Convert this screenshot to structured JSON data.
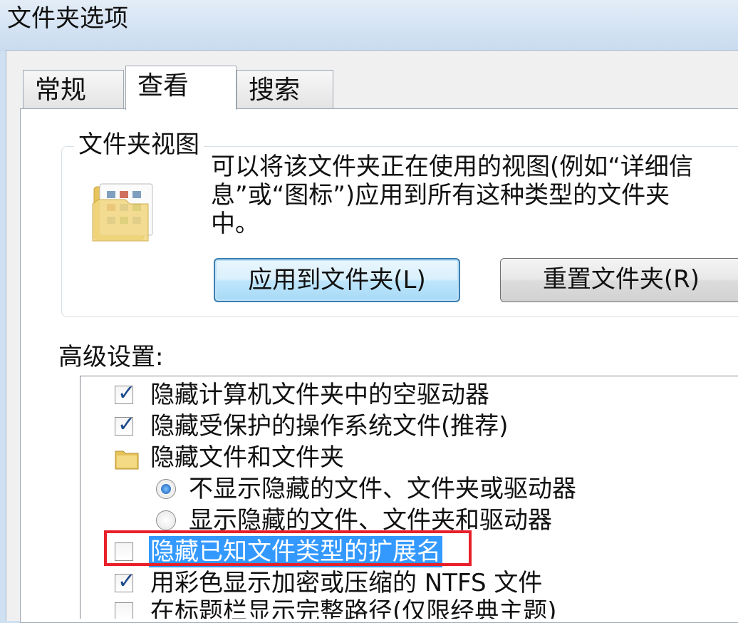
{
  "window": {
    "title": "文件夹选项"
  },
  "tabs": [
    {
      "label": "常规",
      "active": false
    },
    {
      "label": "查看",
      "active": true
    },
    {
      "label": "搜索",
      "active": false
    }
  ],
  "folder_views": {
    "title": "文件夹视图",
    "description_line1": "可以将该文件夹正在使用的视图(例如“详细信",
    "description_line2": "息”或“图标”)应用到所有这种类型的文件夹",
    "description_line3": "中。",
    "apply_button": "应用到文件夹(L)",
    "reset_button": "重置文件夹(R)"
  },
  "advanced": {
    "label": "高级设置:",
    "items": [
      {
        "type": "checkbox",
        "checked": true,
        "label": "隐藏计算机文件夹中的空驱动器"
      },
      {
        "type": "checkbox",
        "checked": true,
        "label": "隐藏受保护的操作系统文件(推荐)"
      },
      {
        "type": "folder",
        "label": "隐藏文件和文件夹"
      },
      {
        "type": "radio",
        "selected": true,
        "label": "不显示隐藏的文件、文件夹或驱动器"
      },
      {
        "type": "radio",
        "selected": false,
        "label": "显示隐藏的文件、文件夹和驱动器"
      },
      {
        "type": "checkbox",
        "checked": false,
        "highlighted": true,
        "label": "隐藏已知文件类型的扩展名"
      },
      {
        "type": "checkbox",
        "checked": true,
        "label": "用彩色显示加密或压缩的 NTFS 文件"
      },
      {
        "type": "checkbox",
        "checked": false,
        "label": "在标题栏显示完整路径(仅限经典主题)"
      }
    ]
  },
  "colors": {
    "selection": "#3399ff",
    "annotation": "#e8202a"
  }
}
